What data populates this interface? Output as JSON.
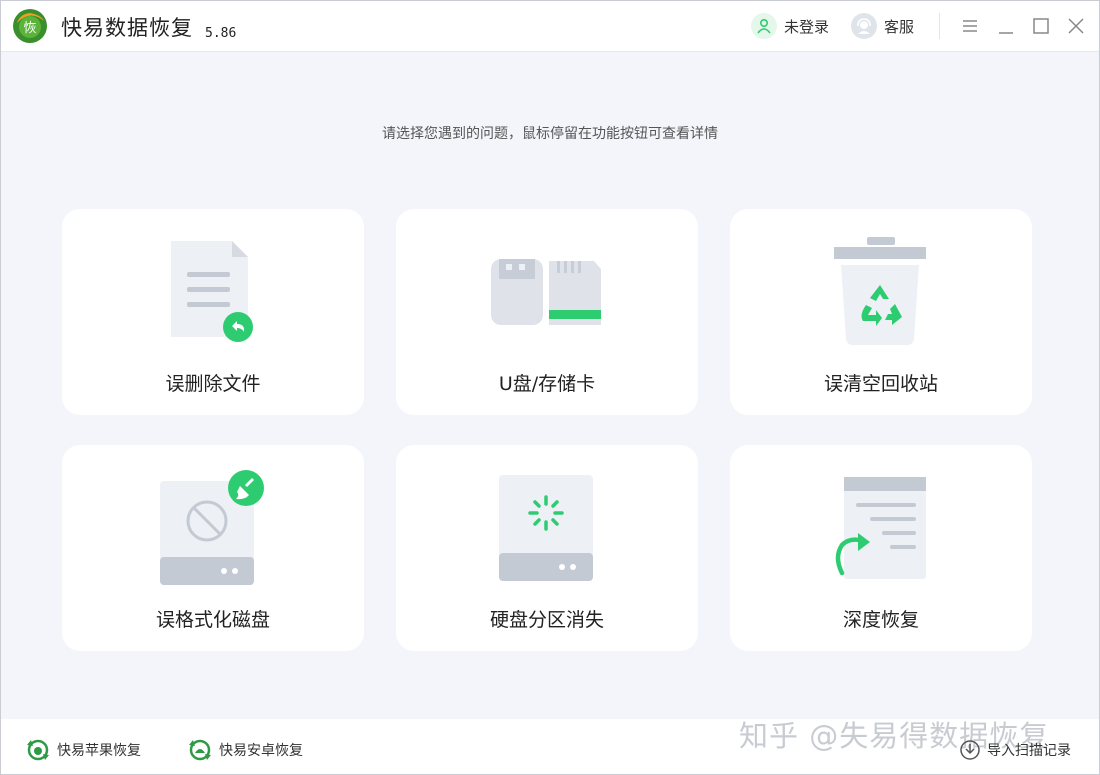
{
  "app": {
    "title": "快易数据恢复",
    "version": "5.86",
    "logo_text": "恢"
  },
  "header": {
    "login_label": "未登录",
    "service_label": "客服"
  },
  "hint": "请选择您遇到的问题，鼠标停留在功能按钮可查看详情",
  "cards": [
    {
      "label": "误删除文件",
      "icon": "deleted-file-icon"
    },
    {
      "label": "U盘/存储卡",
      "icon": "usb-sdcard-icon"
    },
    {
      "label": "误清空回收站",
      "icon": "recycle-bin-icon"
    },
    {
      "label": "误格式化磁盘",
      "icon": "formatted-disk-icon"
    },
    {
      "label": "硬盘分区消失",
      "icon": "lost-partition-icon"
    },
    {
      "label": "深度恢复",
      "icon": "deep-recovery-icon"
    }
  ],
  "footer": {
    "apple_label": "快易苹果恢复",
    "android_label": "快易安卓恢复",
    "import_label": "导入扫描记录"
  },
  "watermark": "知乎 @失易得数据恢复",
  "colors": {
    "accent": "#2ecc71",
    "icon_gray": "#c9d0d9",
    "background": "#f3f5fa"
  }
}
